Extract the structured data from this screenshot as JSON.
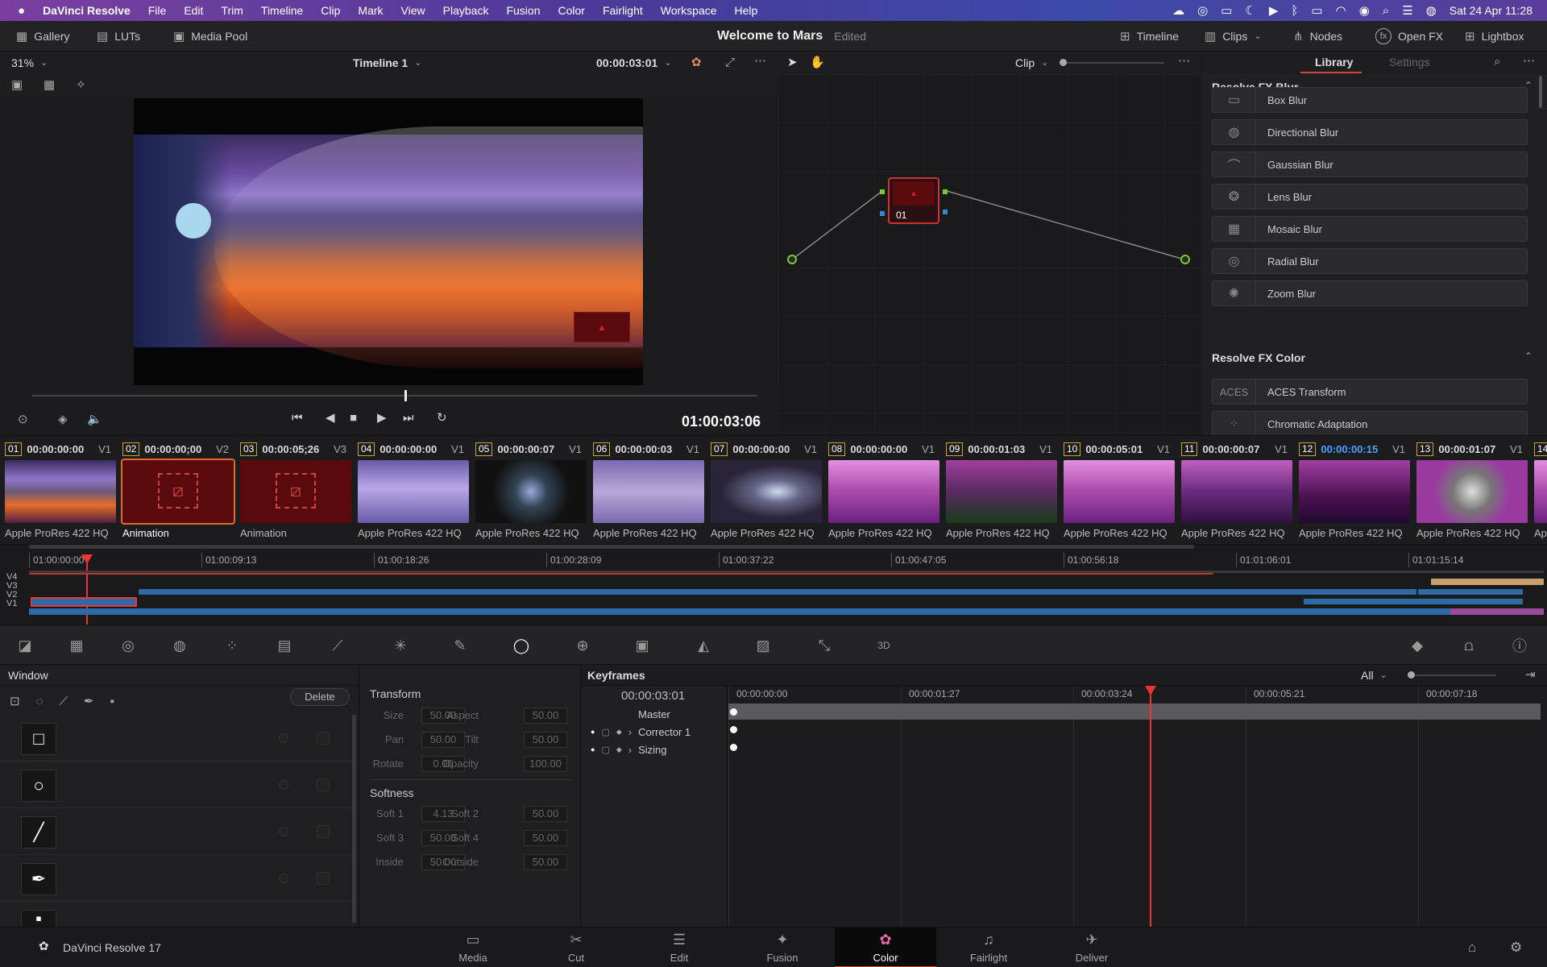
{
  "menubar": {
    "app": "DaVinci Resolve",
    "items": [
      "File",
      "Edit",
      "Trim",
      "Timeline",
      "Clip",
      "Mark",
      "View",
      "Playback",
      "Fusion",
      "Color",
      "Fairlight",
      "Workspace",
      "Help"
    ],
    "datetime": "Sat 24 Apr  11:28"
  },
  "toolbar": {
    "gallery": "Gallery",
    "luts": "LUTs",
    "media_pool": "Media Pool",
    "project_title": "Welcome to Mars",
    "edited": "Edited",
    "timeline": "Timeline",
    "clips": "Clips",
    "nodes": "Nodes",
    "openfx": "Open FX",
    "lightbox": "Lightbox"
  },
  "viewer": {
    "zoom": "31%",
    "timeline_name": "Timeline 1",
    "timecode_top": "00:00:03:01",
    "timecode": "01:00:03:06"
  },
  "node_editor": {
    "mode": "Clip",
    "node_label": "01"
  },
  "library": {
    "tab_library": "Library",
    "tab_settings": "Settings",
    "blur_header": "Resolve FX Blur",
    "blur_items": [
      "Box Blur",
      "Directional Blur",
      "Gaussian Blur",
      "Lens Blur",
      "Mosaic Blur",
      "Radial Blur",
      "Zoom Blur"
    ],
    "color_header": "Resolve FX Color",
    "color_items": [
      "ACES Transform",
      "Chromatic Adaptation"
    ]
  },
  "clips": [
    {
      "num": "01",
      "tc": "00:00:00:00",
      "track": "V1",
      "name": "Apple ProRes 422 HQ",
      "color": "#7a52b0",
      "kind": "planet"
    },
    {
      "num": "02",
      "tc": "00:00:00;00",
      "track": "V2",
      "name": "Animation",
      "color": "#5a0a0c",
      "kind": "missing",
      "active": true
    },
    {
      "num": "03",
      "tc": "00:00:05;26",
      "track": "V3",
      "name": "Animation",
      "color": "#5a0a0c",
      "kind": "missing"
    },
    {
      "num": "04",
      "tc": "00:00:00:00",
      "track": "V1",
      "name": "Apple ProRes 422 HQ",
      "color": "#8a74c8",
      "kind": "streak"
    },
    {
      "num": "05",
      "tc": "00:00:00:07",
      "track": "V1",
      "name": "Apple ProRes 422 HQ",
      "color": "#1a1a2a",
      "kind": "glow"
    },
    {
      "num": "06",
      "tc": "00:00:00:03",
      "track": "V1",
      "name": "Apple ProRes 422 HQ",
      "color": "#7a6ab0",
      "kind": "jet"
    },
    {
      "num": "07",
      "tc": "00:00:00:00",
      "track": "V1",
      "name": "Apple ProRes 422 HQ",
      "color": "#3a3050",
      "kind": "beam"
    },
    {
      "num": "08",
      "tc": "00:00:00:00",
      "track": "V1",
      "name": "Apple ProRes 422 HQ",
      "color": "#b050b0",
      "kind": "pink"
    },
    {
      "num": "09",
      "tc": "00:00:01:03",
      "track": "V1",
      "name": "Apple ProRes 422 HQ",
      "color": "#5a2a60",
      "kind": "pinkdark"
    },
    {
      "num": "10",
      "tc": "00:00:05:01",
      "track": "V1",
      "name": "Apple ProRes 422 HQ",
      "color": "#a04aa8",
      "kind": "pink"
    },
    {
      "num": "11",
      "tc": "00:00:00:07",
      "track": "V1",
      "name": "Apple ProRes 422 HQ",
      "color": "#6a2a80",
      "kind": "city"
    },
    {
      "num": "12",
      "tc": "00:00:00:15",
      "track": "V1",
      "name": "Apple ProRes 422 HQ",
      "color": "#8a2a8a",
      "kind": "gate",
      "tcBlue": true
    },
    {
      "num": "13",
      "tc": "00:00:01:07",
      "track": "V1",
      "name": "Apple ProRes 422 HQ",
      "color": "#9a3aa0",
      "kind": "astro"
    },
    {
      "num": "14",
      "tc": "",
      "track": "",
      "name": "Ap",
      "color": "#6a2a80",
      "kind": "pink"
    }
  ],
  "timeline": {
    "ticks": [
      "01:00:00:00",
      "01:00:09:13",
      "01:00:18:26",
      "01:00:28:09",
      "01:00:37:22",
      "01:00:47:05",
      "01:00:56:18",
      "01:01:06:01",
      "01:01:15:14"
    ],
    "tracks": [
      "V4",
      "V3",
      "V2",
      "V1"
    ]
  },
  "window_panel": {
    "title": "Window",
    "delete": "Delete"
  },
  "transform": {
    "title": "Transform",
    "fields": [
      {
        "l": "Size",
        "v": "50.00"
      },
      {
        "l": "Aspect",
        "v": "50.00"
      },
      {
        "l": "Pan",
        "v": "50.00"
      },
      {
        "l": "Tilt",
        "v": "50.00"
      },
      {
        "l": "Rotate",
        "v": "0.00"
      },
      {
        "l": "Opacity",
        "v": "100.00"
      }
    ],
    "softness_title": "Softness",
    "softness": [
      {
        "l": "Soft 1",
        "v": "4.13"
      },
      {
        "l": "Soft 2",
        "v": "50.00"
      },
      {
        "l": "Soft 3",
        "v": "50.00"
      },
      {
        "l": "Soft 4",
        "v": "50.00"
      },
      {
        "l": "Inside",
        "v": "50.00"
      },
      {
        "l": "Outside",
        "v": "50.00"
      }
    ]
  },
  "keyframes": {
    "title": "Keyframes",
    "filter": "All",
    "timecode": "00:00:03:01",
    "ticks": [
      "00:00:00:00",
      "00:00:01:27",
      "00:00:03:24",
      "00:00:05:21",
      "00:00:07:18"
    ],
    "rows": [
      "Master",
      "Corrector 1",
      "Sizing"
    ]
  },
  "pages": {
    "app_version": "DaVinci Resolve 17",
    "items": [
      "Media",
      "Cut",
      "Edit",
      "Fusion",
      "Color",
      "Fairlight",
      "Deliver"
    ],
    "active": "Color"
  }
}
